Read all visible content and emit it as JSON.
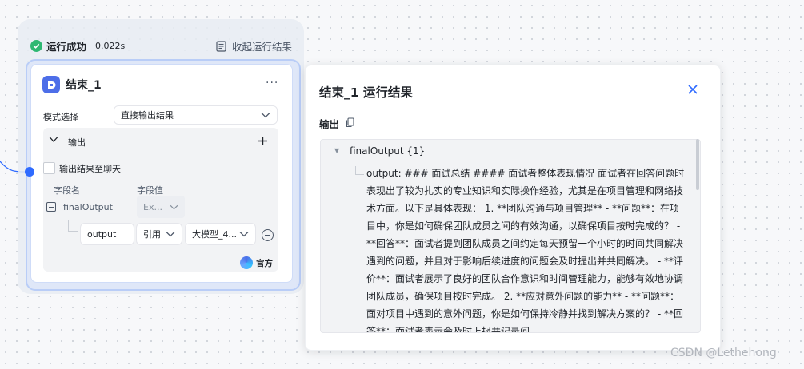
{
  "run_status": {
    "text": "运行成功",
    "time": "0.022s",
    "collapse_label": "收起运行结果",
    "success_color": "#2eb872"
  },
  "node": {
    "title": "结束_1",
    "more_label": "···",
    "mode_label": "模式选择",
    "mode_value": "直接输出结果",
    "output_section_label": "输出",
    "checkbox_label": "输出结果至聊天",
    "col_field_name": "字段名",
    "col_field_value": "字段值",
    "field": {
      "name": "finalOutput",
      "value": "Ex..."
    },
    "subfield": {
      "name": "output",
      "ref_type": "引用",
      "ref_value": "大模型_4..."
    },
    "badge": "官方",
    "accent_color": "#4d6ee8"
  },
  "panel": {
    "title": "结束_1 运行结果",
    "output_label": "输出",
    "root_key": "finalOutput {1}",
    "output_text": "output: ### 面试总结 #### 面试者整体表现情况 面试者在回答问题时表现出了较为扎实的专业知识和实际操作经验，尤其是在项目管理和网络技术方面。以下是具体表现： 1. **团队沟通与项目管理** - **问题**：在项目中，你是如何确保团队成员之间的有效沟通，以确保项目按时完成的？ - **回答**：面试者提到团队成员之间约定每天预留一个小时的时间共同解决遇到的问题，并且对于影响后续进度的问题会及时提出并共同解决。 - **评价**：面试者展示了良好的团队合作意识和时间管理能力，能够有效地协调团队成员，确保项目按时完成。 2. **应对意外问题的能力** - **问题**：面对项目中遇到的意外问题，你是如何保持冷静并找到解决方案的？ - **回答**：面试者表示会及时上报并记录问",
    "close_color": "#2f6bff"
  },
  "watermark": "CSDN @Lethehong"
}
